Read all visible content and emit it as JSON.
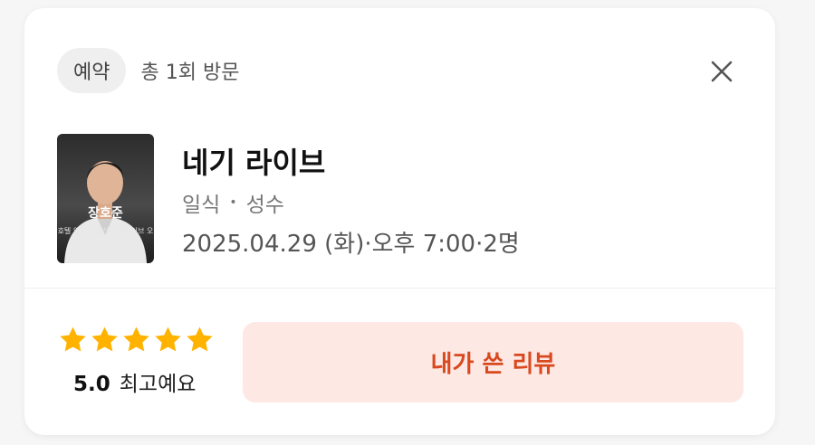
{
  "header": {
    "badge_label": "예약",
    "visit_count": "총 1회 방문"
  },
  "restaurant": {
    "thumbnail": {
      "name_text": "장호준",
      "caption_text": "호텔 일식당 출신 네기타이브 오"
    },
    "name": "네기 라이브",
    "category": "일식",
    "separator": "•",
    "location": "성수",
    "datetime": "2025.04.29 (화)·오후 7:00·2명"
  },
  "rating": {
    "stars": 5,
    "max_stars": 5,
    "score": "5.0",
    "label": "최고예요"
  },
  "review_button": {
    "label": "내가 쓴 리뷰"
  },
  "icons": {
    "close": "close-icon",
    "star": "star-icon"
  },
  "colors": {
    "star": "#FFB300",
    "accent": "#D9491F",
    "accent_bg": "#FDE8E3",
    "badge_bg": "#EFEFEF"
  }
}
